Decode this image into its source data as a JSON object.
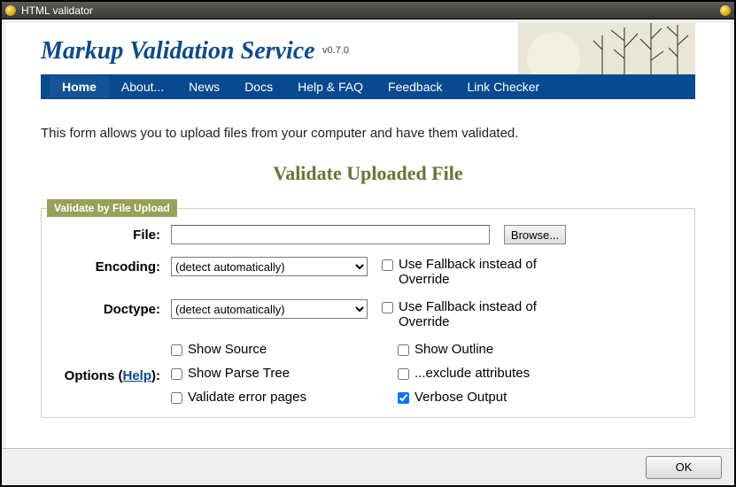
{
  "window": {
    "title": "HTML validator"
  },
  "banner": {
    "title": "Markup Validation Service",
    "version": "v0.7.0"
  },
  "nav": {
    "items": [
      {
        "label": "Home",
        "active": true
      },
      {
        "label": "About..."
      },
      {
        "label": "News"
      },
      {
        "label": "Docs"
      },
      {
        "label": "Help & FAQ"
      },
      {
        "label": "Feedback"
      },
      {
        "label": "Link Checker"
      }
    ]
  },
  "intro": "This form allows you to upload files from your computer and have them validated.",
  "section_title": "Validate Uploaded File",
  "legend": "Validate by File Upload",
  "labels": {
    "file": "File:",
    "encoding": "Encoding:",
    "doctype": "Doctype:",
    "options_pre": "Options (",
    "options_help": "Help",
    "options_post": "):"
  },
  "buttons": {
    "browse": "Browse...",
    "ok": "OK"
  },
  "encoding": {
    "selected": "(detect automatically)",
    "fallback_label": "Use Fallback instead of Override",
    "fallback_checked": false
  },
  "doctype": {
    "selected": "(detect automatically)",
    "fallback_label": "Use Fallback instead of Override",
    "fallback_checked": false
  },
  "options": {
    "left": [
      {
        "label": "Show Source",
        "checked": false
      },
      {
        "label": "Show Parse Tree",
        "checked": false
      },
      {
        "label": "Validate error pages",
        "checked": false
      }
    ],
    "right": [
      {
        "label": "Show Outline",
        "checked": false
      },
      {
        "label": "...exclude attributes",
        "checked": false
      },
      {
        "label": "Verbose Output",
        "checked": true
      }
    ]
  }
}
